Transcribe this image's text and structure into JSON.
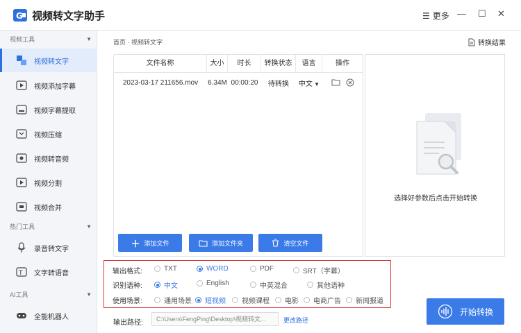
{
  "app": {
    "title": "视频转文字助手",
    "more_label": "更多"
  },
  "sidebar": {
    "sections": [
      {
        "title": "视频工具",
        "items": [
          "视频转文字",
          "视频添加字幕",
          "视频字幕提取",
          "视频压缩",
          "视频转音频",
          "视频分割",
          "视频合并"
        ]
      },
      {
        "title": "热门工具",
        "items": [
          "录音转文字",
          "文字转语音"
        ]
      },
      {
        "title": "AI工具",
        "items": [
          "全能机器人"
        ]
      }
    ],
    "active_item": "视频转文字"
  },
  "breadcrumb": {
    "home": "首页",
    "sep": " · ",
    "current": "视频转文字"
  },
  "result_link": "转换结果",
  "table": {
    "headers": [
      "文件名称",
      "大小",
      "时长",
      "转换状态",
      "语言",
      "操作"
    ],
    "rows": [
      {
        "name": "2023-03-17 211656.mov",
        "size": "6.34M",
        "duration": "00:00:20",
        "status": "待转换",
        "lang": "中文"
      }
    ]
  },
  "buttons": {
    "add_file": "添加文件",
    "add_folder": "添加文件夹",
    "clear_files": "清空文件"
  },
  "preview": {
    "hint": "选择好参数后点击开始转换"
  },
  "options": {
    "format": {
      "label": "输出格式:",
      "choices": [
        "TXT",
        "WORD",
        "PDF",
        "SRT（字幕）"
      ],
      "selected": "WORD"
    },
    "language": {
      "label": "识别语种:",
      "choices": [
        "中文",
        "English",
        "中英混合",
        "其他语种"
      ],
      "selected": "中文"
    },
    "scene": {
      "label": "使用场景:",
      "choices": [
        "通用场景",
        "短视频",
        "视频课程",
        "电影",
        "电商广告",
        "新闻报道"
      ],
      "selected": "短视频"
    }
  },
  "output": {
    "label": "输出路径:",
    "path": "C:\\Users\\FengPing\\Desktop\\视频转文...",
    "change": "更改路径"
  },
  "start_button": "开始转换",
  "colors": {
    "accent": "#3b7be8",
    "highlight_border": "#d83a3a",
    "sidebar_bg": "#f3f5f8"
  }
}
